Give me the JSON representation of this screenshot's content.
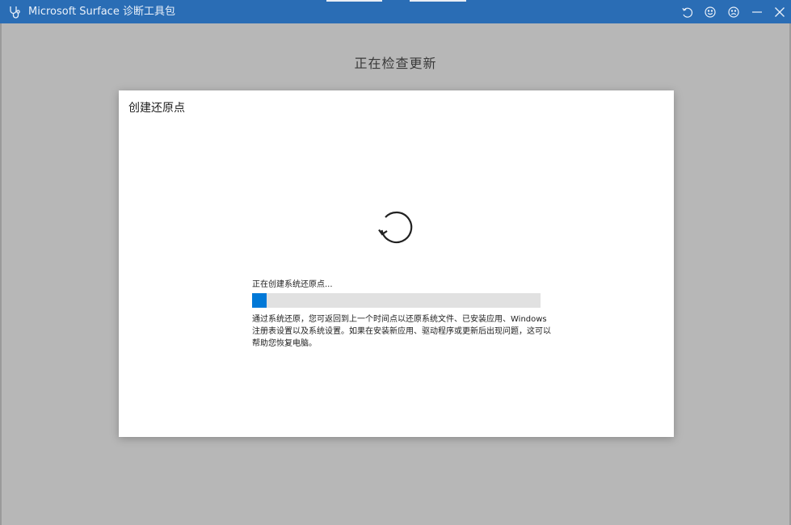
{
  "titlebar": {
    "title": "Microsoft Surface 诊断工具包",
    "icons": [
      "stethoscope-icon",
      "restart-icon",
      "smile-icon",
      "frown-icon",
      "minimize-icon",
      "close-icon"
    ]
  },
  "page": {
    "heading": "正在检查更新"
  },
  "dialog": {
    "title": "创建还原点",
    "spinner_icon": "restore-icon",
    "status": "正在创建系统还原点...",
    "progress_fraction": 0.05,
    "description": "通过系统还原，您可返回到上一个时间点以还原系统文件、已安装应用、Windows 注册表设置以及系统设置。如果在安装新应用、驱动程序或更新后出现问题，这可以帮助您恢复电脑。"
  },
  "colors": {
    "titlebar": "#2a6db5",
    "accent": "#0078d7",
    "background": "#b7b7b7"
  }
}
